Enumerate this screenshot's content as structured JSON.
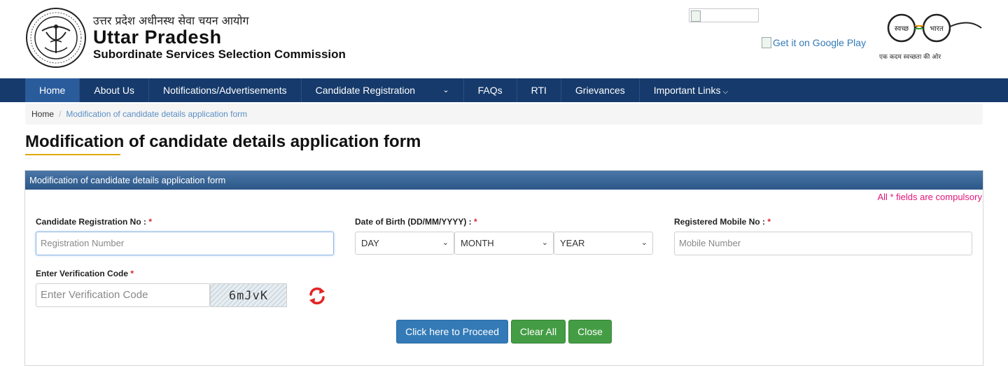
{
  "header": {
    "org_hindi": "उत्तर प्रदेश अधीनस्थ सेवा चयन आयोग",
    "org_title": "Uttar Pradesh",
    "org_subtitle": "Subordinate Services Selection Commission",
    "google_play_alt": "Get it on Google Play",
    "swachh_text_left": "स्वच्छ",
    "swachh_text_right": "भारत",
    "swachh_tagline": "एक कदम स्वच्छता की ओर"
  },
  "nav": {
    "items": [
      {
        "label": "Home"
      },
      {
        "label": "About Us"
      },
      {
        "label": "Notifications/Advertisements"
      },
      {
        "label": "Candidate Registration"
      },
      {
        "label": "FAQs"
      },
      {
        "label": "RTI"
      },
      {
        "label": "Grievances"
      },
      {
        "label": "Important Links"
      }
    ]
  },
  "breadcrumb": {
    "home": "Home",
    "separator": "/",
    "current": "Modification of candidate details application form"
  },
  "page": {
    "title": "Modification of candidate details application form"
  },
  "form": {
    "panel_title": "Modification of candidate details application form",
    "compulsory_note": "All * fields are compulsory",
    "registration_label": "Candidate Registration No : ",
    "registration_placeholder": "Registration Number",
    "dob_label": "Date of Birth (DD/MM/YYYY) : ",
    "day_value": "DAY",
    "month_value": "MONTH",
    "year_value": "YEAR",
    "mobile_label": "Registered Mobile No : ",
    "mobile_placeholder": "Mobile Number",
    "verification_label": "Enter Verification Code ",
    "verification_placeholder": "Enter Verification Code",
    "captcha_text": "6mJvK",
    "required_mark": "*",
    "proceed_label": "Click here to Proceed",
    "clear_label": "Clear All",
    "close_label": "Close"
  },
  "colors": {
    "nav_bg": "#163a6b",
    "nav_active": "#2a5c9c",
    "primary": "#337ab7",
    "success": "#449d44",
    "required": "#d9232d",
    "compulsory_note": "#e0157a",
    "underline_accent": "#e0a800"
  }
}
